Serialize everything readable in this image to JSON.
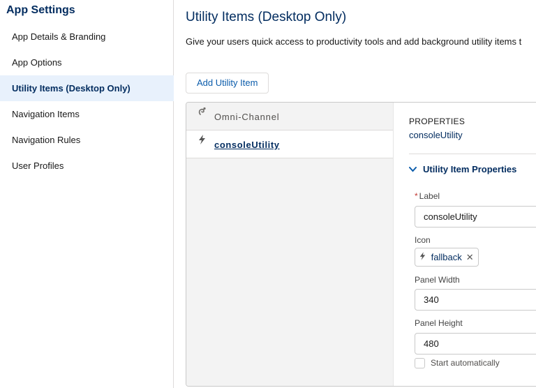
{
  "sidebar": {
    "title": "App Settings",
    "items": [
      {
        "label": "App Details & Branding"
      },
      {
        "label": "App Options"
      },
      {
        "label": "Utility Items (Desktop Only)"
      },
      {
        "label": "Navigation Items"
      },
      {
        "label": "Navigation Rules"
      },
      {
        "label": "User Profiles"
      }
    ],
    "active_item": "Utility Items (Desktop Only)"
  },
  "main": {
    "title": "Utility Items (Desktop Only)",
    "description": "Give your users quick access to productivity tools and add background utility items t",
    "add_button_label": "Add Utility Item"
  },
  "utility_list": [
    {
      "label": "Omni-Channel",
      "icon": "omni-channel-icon"
    },
    {
      "label": "consoleUtility",
      "icon": "lightning-bolt-icon",
      "selected": true
    }
  ],
  "properties": {
    "kicker": "PROPERTIES",
    "name": "consoleUtility",
    "section_title": "Utility Item Properties",
    "label_field": {
      "label": "Label",
      "value": "consoleUtility",
      "required": true
    },
    "icon_field": {
      "label": "Icon",
      "value": "fallback",
      "icon": "lightning-bolt-icon"
    },
    "panel_width": {
      "label": "Panel Width",
      "value": "340"
    },
    "panel_height": {
      "label": "Panel Height",
      "value": "480"
    },
    "start_automatically": {
      "label": "Start automatically",
      "checked": false
    }
  },
  "colors": {
    "accent": "#0b5cab",
    "title": "#032d60",
    "active_bg": "#e8f1fc",
    "required": "#c23934"
  }
}
